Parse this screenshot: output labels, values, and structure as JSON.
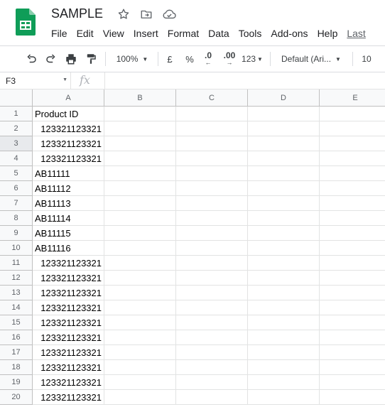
{
  "app": {
    "doc_title": "SAMPLE",
    "menu": [
      "File",
      "Edit",
      "View",
      "Insert",
      "Format",
      "Data",
      "Tools",
      "Add-ons",
      "Help"
    ],
    "last_edit": "Last",
    "brand_color": "#0f9d58"
  },
  "toolbar": {
    "undo_icon": "undo-icon",
    "redo_icon": "redo-icon",
    "print_icon": "print-icon",
    "paint_format_icon": "paint-format-icon",
    "zoom": "100%",
    "currency": "£",
    "percent": "%",
    "decrease_decimal": ".0",
    "increase_decimal": ".00",
    "more_formats": "123",
    "font": "Default (Ari...",
    "font_size": "10"
  },
  "formula_bar": {
    "name_box": "F3",
    "fx_label": "fx",
    "formula": ""
  },
  "sheet": {
    "columns": [
      "A",
      "B",
      "C",
      "D",
      "E"
    ],
    "selected_row": 3,
    "rows": [
      {
        "num": "1",
        "a": "Product ID",
        "type": "txt"
      },
      {
        "num": "2",
        "a": "123321123321",
        "type": "num"
      },
      {
        "num": "3",
        "a": "123321123321",
        "type": "num"
      },
      {
        "num": "4",
        "a": "123321123321",
        "type": "num"
      },
      {
        "num": "5",
        "a": "AB11111",
        "type": "txt"
      },
      {
        "num": "6",
        "a": "AB11112",
        "type": "txt"
      },
      {
        "num": "7",
        "a": "AB11113",
        "type": "txt"
      },
      {
        "num": "8",
        "a": "AB11114",
        "type": "txt"
      },
      {
        "num": "9",
        "a": "AB11115",
        "type": "txt"
      },
      {
        "num": "10",
        "a": "AB11116",
        "type": "txt"
      },
      {
        "num": "11",
        "a": "123321123321",
        "type": "num"
      },
      {
        "num": "12",
        "a": "123321123321",
        "type": "num"
      },
      {
        "num": "13",
        "a": "123321123321",
        "type": "num"
      },
      {
        "num": "14",
        "a": "123321123321",
        "type": "num"
      },
      {
        "num": "15",
        "a": "123321123321",
        "type": "num"
      },
      {
        "num": "16",
        "a": "123321123321",
        "type": "num"
      },
      {
        "num": "17",
        "a": "123321123321",
        "type": "num"
      },
      {
        "num": "18",
        "a": "123321123321",
        "type": "num"
      },
      {
        "num": "19",
        "a": "123321123321",
        "type": "num"
      },
      {
        "num": "20",
        "a": "123321123321",
        "type": "num"
      }
    ]
  }
}
